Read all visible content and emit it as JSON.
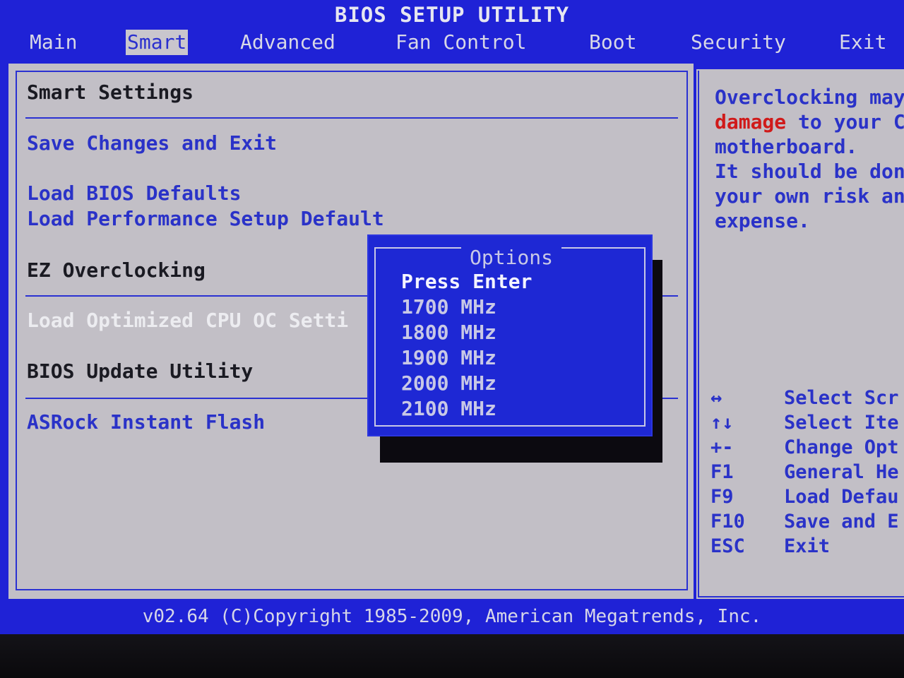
{
  "app": {
    "title": "BIOS SETUP UTILITY"
  },
  "tabs": [
    {
      "label": "Main"
    },
    {
      "label": "Smart"
    },
    {
      "label": "Advanced"
    },
    {
      "label": "Fan Control"
    },
    {
      "label": "Boot"
    },
    {
      "label": "Security"
    },
    {
      "label": "Exit"
    }
  ],
  "active_tab": "Smart",
  "left": {
    "section_smart": "Smart Settings",
    "save_exit": "Save Changes and Exit",
    "load_bios_defaults": "Load BIOS Defaults",
    "load_perf_defaults": "Load Performance Setup Default",
    "section_ez": "EZ Overclocking",
    "load_opt_cpu": "Load Optimized CPU OC Setti",
    "section_update": "BIOS Update Utility",
    "instant_flash": "ASRock Instant Flash"
  },
  "help": {
    "lines": [
      {
        "text": "Overclocking may"
      },
      {
        "warn": "damage",
        "text": " to your C"
      },
      {
        "text": "motherboard."
      },
      {
        "text": "It should be don"
      },
      {
        "text": "your own risk an"
      },
      {
        "text": "expense."
      }
    ]
  },
  "keys": [
    {
      "key": "↔",
      "desc": "Select Scr"
    },
    {
      "key": "↑↓",
      "desc": "Select Ite"
    },
    {
      "key": "+-",
      "desc": "Change Opt"
    },
    {
      "key": "F1",
      "desc": "General He"
    },
    {
      "key": "F9",
      "desc": "Load Defau"
    },
    {
      "key": "F10",
      "desc": "Save and E"
    },
    {
      "key": "ESC",
      "desc": "Exit"
    }
  ],
  "dialog": {
    "title": "Options",
    "options": [
      "Press Enter",
      "1700 MHz",
      "1800 MHz",
      "1900 MHz",
      "2000 MHz",
      "2100 MHz"
    ],
    "selected": "Press Enter"
  },
  "footer": "v02.64 (C)Copyright 1985-2009, American Megatrends, Inc.",
  "colors": {
    "screen_blue": "#1f22d6",
    "panel_gray": "#c2bfc6",
    "link_blue": "#2a32c8",
    "warning_red": "#d01a1a"
  }
}
